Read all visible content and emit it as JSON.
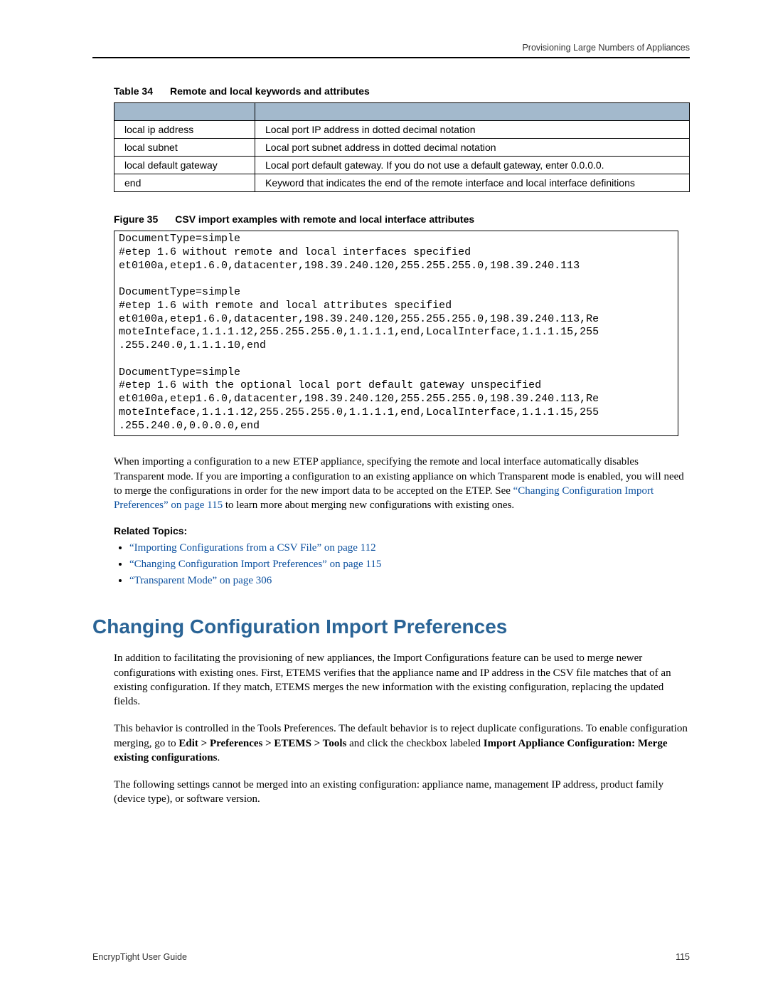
{
  "header": {
    "right": "Provisioning Large Numbers of Appliances"
  },
  "table_caption": {
    "prefix": "Table 34",
    "title": "Remote and local keywords and attributes"
  },
  "table": {
    "rows": [
      {
        "a": "local ip address",
        "b": "Local port IP address in dotted decimal notation"
      },
      {
        "a": "local subnet",
        "b": "Local port subnet address in dotted decimal notation"
      },
      {
        "a": "local default gateway",
        "b": "Local port default gateway. If you do not use a default gateway, enter 0.0.0.0."
      },
      {
        "a": "end",
        "b": "Keyword that indicates the end of the remote interface and local interface definitions"
      }
    ]
  },
  "figure_caption": {
    "prefix": "Figure 35",
    "title": "CSV import examples with remote and local interface attributes"
  },
  "codebox": "DocumentType=simple\n#etep 1.6 without remote and local interfaces specified\net0100a,etep1.6.0,datacenter,198.39.240.120,255.255.255.0,198.39.240.113\n\nDocumentType=simple\n#etep 1.6 with remote and local attributes specified\net0100a,etep1.6.0,datacenter,198.39.240.120,255.255.255.0,198.39.240.113,Re\nmoteInteface,1.1.1.12,255.255.255.0,1.1.1.1,end,LocalInterface,1.1.1.15,255\n.255.240.0,1.1.1.10,end\n\nDocumentType=simple\n#etep 1.6 with the optional local port default gateway unspecified\net0100a,etep1.6.0,datacenter,198.39.240.120,255.255.255.0,198.39.240.113,Re\nmoteInteface,1.1.1.12,255.255.255.0,1.1.1.1,end,LocalInterface,1.1.1.15,255\n.255.240.0,0.0.0.0,end",
  "para1": {
    "pre": "When importing a configuration to a new ETEP appliance, specifying the remote and local interface automatically disables Transparent mode. If you are importing a configuration to an existing appliance on which Transparent mode is enabled, you will need to merge the configurations in order for the new import data to be accepted on the ETEP. See ",
    "link": "“Changing Configuration Import Preferences” on page 115",
    "post": " to learn more about merging new configurations with existing ones."
  },
  "related_heading": "Related Topics:",
  "related": [
    "“Importing Configurations from a CSV File” on page 112",
    "“Changing Configuration Import Preferences” on page 115",
    "“Transparent Mode” on page 306"
  ],
  "section_title": "Changing Configuration Import Preferences",
  "para2": "In addition to facilitating the provisioning of new appliances, the Import Configurations feature can be used to merge newer configurations with existing ones. First, ETEMS verifies that the appliance name and IP address in the CSV file matches that of an existing configuration. If they match, ETEMS merges the new information with the existing configuration, replacing the updated fields.",
  "para3": {
    "pre": "This behavior is controlled in the Tools Preferences. The default behavior is to reject duplicate configurations. To enable configuration merging, go to ",
    "b1": "Edit > Preferences > ETEMS > Tools",
    "mid": " and click the checkbox labeled ",
    "b2": "Import Appliance Configuration: Merge existing configurations",
    "post": "."
  },
  "para4": "The following settings cannot be merged into an existing configuration: appliance name, management IP address, product family (device type), or software version.",
  "footer": {
    "left": "EncrypTight User Guide",
    "right": "115"
  }
}
